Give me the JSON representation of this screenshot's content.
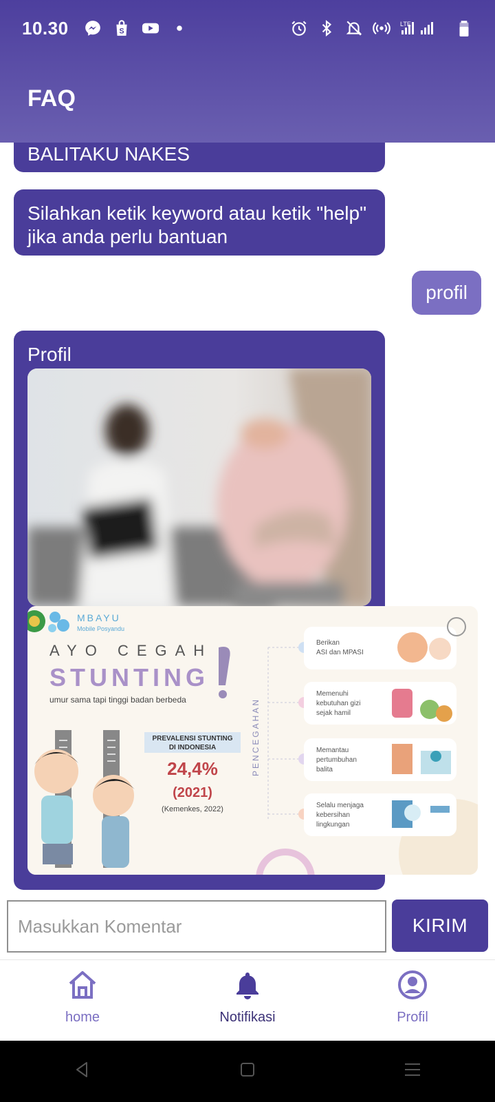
{
  "status_bar": {
    "time": "10.30",
    "network_label": "LTE",
    "icons": [
      "messenger-icon",
      "shop-icon",
      "youtube-icon",
      "dot-icon",
      "alarm-icon",
      "bluetooth-icon",
      "mute-icon",
      "hotspot-icon",
      "signal-icon",
      "battery-icon"
    ]
  },
  "header": {
    "title": "FAQ"
  },
  "chat": {
    "messages": [
      {
        "from": "bot",
        "text": "BALITAKU NAKES"
      },
      {
        "from": "bot",
        "text": "Silahkan ketik keyword atau ketik \"help\" jika anda perlu bantuan"
      },
      {
        "from": "user",
        "text": "profil"
      },
      {
        "from": "bot",
        "text": "Profil"
      }
    ],
    "infographic": {
      "brand": "MBAYU",
      "brand_sub": "Mobile Posyandu",
      "headline": "AYO CEGAH",
      "headline_big": "STUNTING",
      "tagline": "umur sama tapi tinggi badan berbeda",
      "prevalence_title": "PREVALENSI STUNTING DI INDONESIA",
      "prevalence_value": "24,4%",
      "prevalence_year": "(2021)",
      "prevalence_source": "(Kemenkes, 2022)",
      "vertical_label": "PENCEGAHAN",
      "prevention_items": [
        "Berikan ASI dan MPASI",
        "Memenuhi kebutuhan gizi sejak hamil",
        "Memantau pertumbuhan balita",
        "Selalu menjaga kebersihan lingkungan"
      ]
    }
  },
  "input": {
    "placeholder": "Masukkan Komentar",
    "value": ""
  },
  "send_button": {
    "label": "KIRIM"
  },
  "bottom_nav": {
    "items": [
      {
        "label": "home",
        "icon": "home-icon"
      },
      {
        "label": "Notifikasi",
        "icon": "bell-icon"
      },
      {
        "label": "Profil",
        "icon": "profile-icon"
      }
    ]
  },
  "colors": {
    "primary": "#4a3d9a",
    "accent": "#7b6fc2",
    "header_gradient_end": "#6a5fb0"
  }
}
